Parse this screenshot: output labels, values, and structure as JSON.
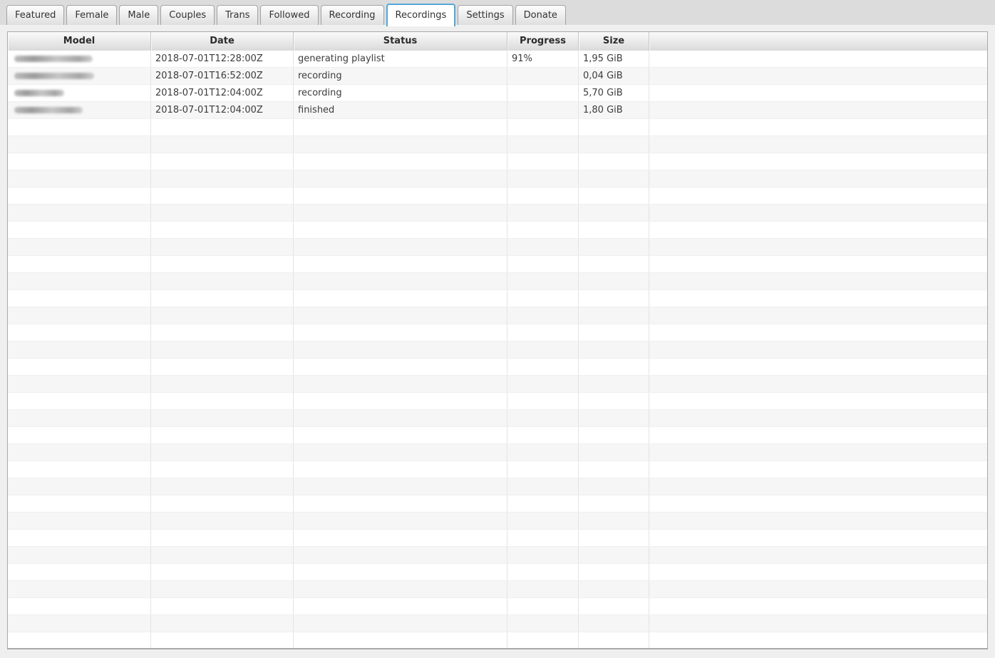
{
  "tabs": [
    {
      "label": "Featured",
      "active": false
    },
    {
      "label": "Female",
      "active": false
    },
    {
      "label": "Male",
      "active": false
    },
    {
      "label": "Couples",
      "active": false
    },
    {
      "label": "Trans",
      "active": false
    },
    {
      "label": "Followed",
      "active": false
    },
    {
      "label": "Recording",
      "active": false
    },
    {
      "label": "Recordings",
      "active": true
    },
    {
      "label": "Settings",
      "active": false
    },
    {
      "label": "Donate",
      "active": false
    }
  ],
  "recordings_table": {
    "columns": [
      {
        "key": "model",
        "label": "Model"
      },
      {
        "key": "date",
        "label": "Date"
      },
      {
        "key": "status",
        "label": "Status"
      },
      {
        "key": "progress",
        "label": "Progress"
      },
      {
        "key": "size",
        "label": "Size"
      },
      {
        "key": "fill",
        "label": ""
      }
    ],
    "rows": [
      {
        "model_redacted": true,
        "model_blur_width": 110,
        "date": "2018-07-01T12:28:00Z",
        "status": "generating playlist",
        "progress": "91%",
        "size": "1,95 GiB"
      },
      {
        "model_redacted": true,
        "model_blur_width": 112,
        "date": "2018-07-01T16:52:00Z",
        "status": "recording",
        "progress": "",
        "size": "0,04 GiB"
      },
      {
        "model_redacted": true,
        "model_blur_width": 70,
        "date": "2018-07-01T12:04:00Z",
        "status": "recording",
        "progress": "",
        "size": "5,70 GiB"
      },
      {
        "model_redacted": true,
        "model_blur_width": 96,
        "date": "2018-07-01T12:04:00Z",
        "status": "finished",
        "progress": "",
        "size": "1,80 GiB"
      }
    ],
    "empty_row_count": 31
  },
  "colors": {
    "active_tab_border": "#55a7d8",
    "tabbar_background": "#dcdcdc",
    "page_background": "#efefef",
    "row_stripe": "#f6f6f6"
  }
}
